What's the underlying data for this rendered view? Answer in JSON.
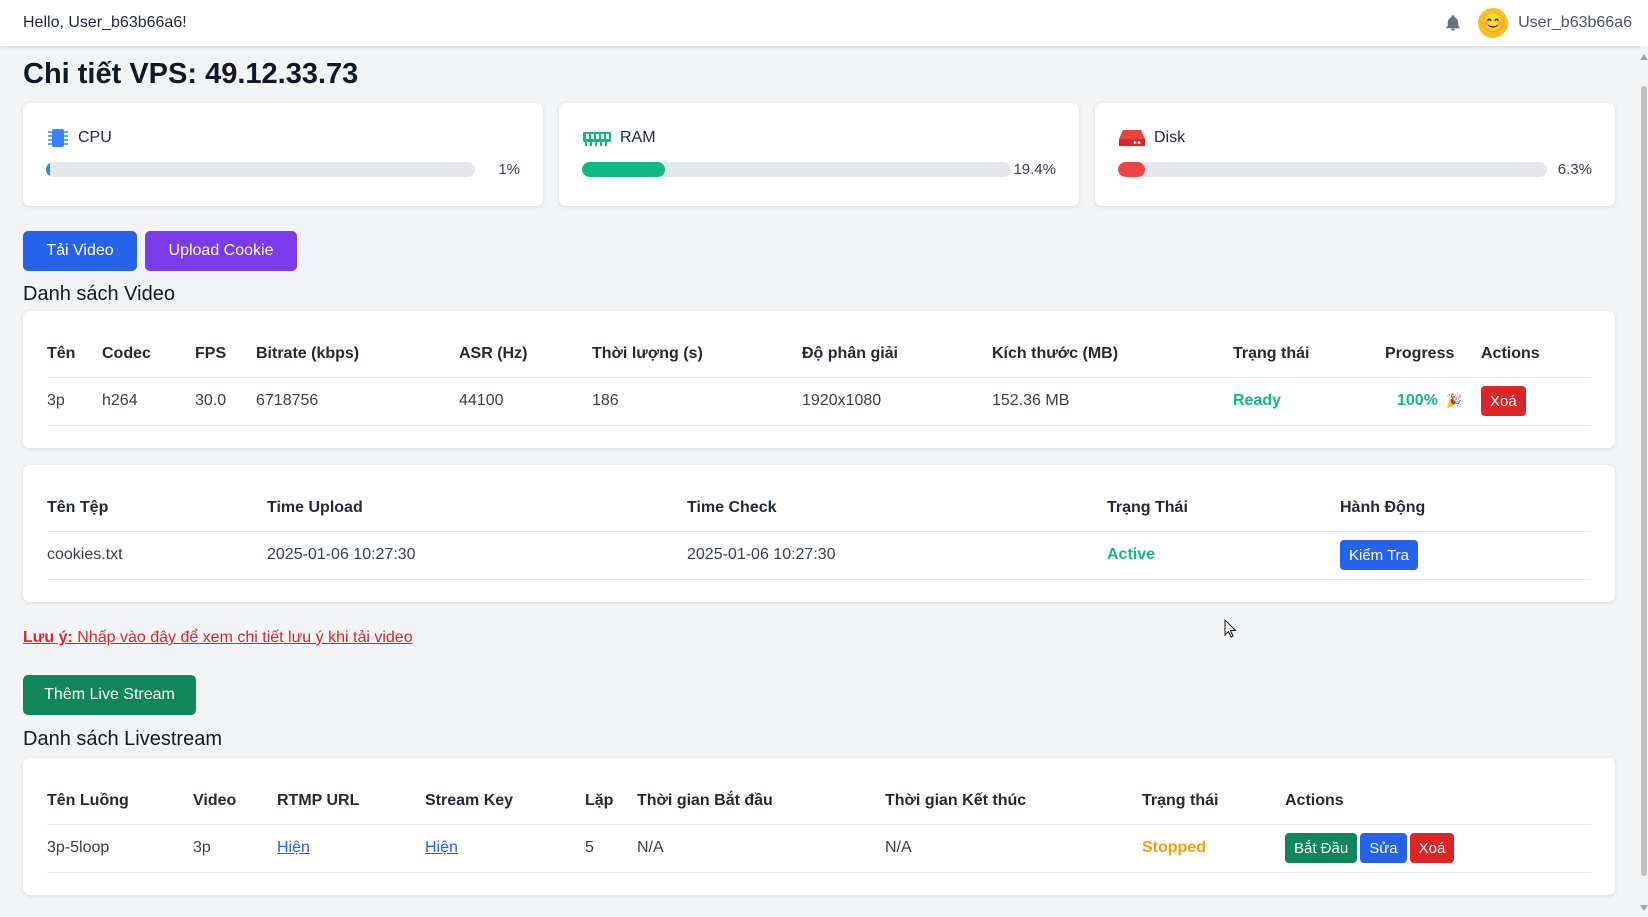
{
  "header": {
    "greeting": "Hello, User_b63b66a6!",
    "username": "User_b63b66a6",
    "bell_icon": "bell-icon",
    "avatar_emoji": "😊"
  },
  "page_title": "Chi tiết VPS: 49.12.33.73",
  "stats": {
    "cpu": {
      "label": "CPU",
      "value": "1%",
      "percent": 1,
      "color": "#3b82f6",
      "icon": "cpu-icon"
    },
    "ram": {
      "label": "RAM",
      "value": "19.4%",
      "percent": 19.4,
      "color": "#10b981",
      "icon": "memory-icon"
    },
    "disk": {
      "label": "Disk",
      "value": "6.3%",
      "percent": 6.3,
      "color": "#ef4444",
      "icon": "hard-drive-icon"
    }
  },
  "buttons": {
    "download_video": "Tải Video",
    "upload_cookie": "Upload Cookie",
    "add_livestream": "Thêm Live Stream"
  },
  "colors": {
    "blue": "#2563eb",
    "purple": "#7c3aed",
    "green": "#10875a",
    "red": "#dc2626",
    "ready": "#10b981",
    "stopped": "#f59e0b"
  },
  "video_section": {
    "title": "Danh sách Video",
    "headers": [
      "Tên",
      "Codec",
      "FPS",
      "Bitrate (kbps)",
      "ASR (Hz)",
      "Thời lượng (s)",
      "Độ phân giải",
      "Kích thước (MB)",
      "Trạng thái",
      "Progress",
      "Actions"
    ],
    "rows": [
      {
        "name": "3p",
        "codec": "h264",
        "fps": "30.0",
        "bitrate": "6718756",
        "asr": "44100",
        "duration": "186",
        "resolution": "1920x1080",
        "size": "152.36 MB",
        "status": "Ready",
        "progress": "100%",
        "progress_icon": "🎉",
        "delete": "Xoá"
      }
    ]
  },
  "cookie_section": {
    "headers": [
      "Tên Tệp",
      "Time Upload",
      "Time Check",
      "Trạng Thái",
      "Hành Động"
    ],
    "rows": [
      {
        "file": "cookies.txt",
        "time_upload": "2025-01-06 10:27:30",
        "time_check": "2025-01-06 10:27:30",
        "status": "Active",
        "action": "Kiểm Tra"
      }
    ]
  },
  "note": {
    "label": "Lưu ý:",
    "text": " Nhấp vào đây để xem chi tiết lưu ý khi tải video"
  },
  "livestream_section": {
    "title": "Danh sách Livestream",
    "headers": [
      "Tên Luồng",
      "Video",
      "RTMP URL",
      "Stream Key",
      "Lặp",
      "Thời gian Bắt đầu",
      "Thời gian Kết thúc",
      "Trạng thái",
      "Actions"
    ],
    "rows": [
      {
        "name": "3p-5loop",
        "video": "3p",
        "rtmp": "Hiện",
        "key": "Hiện",
        "loop": "5",
        "start": "N/A",
        "end": "N/A",
        "status": "Stopped",
        "start_btn": "Bắt Đầu",
        "edit_btn": "Sửa",
        "delete_btn": "Xoá"
      }
    ]
  }
}
